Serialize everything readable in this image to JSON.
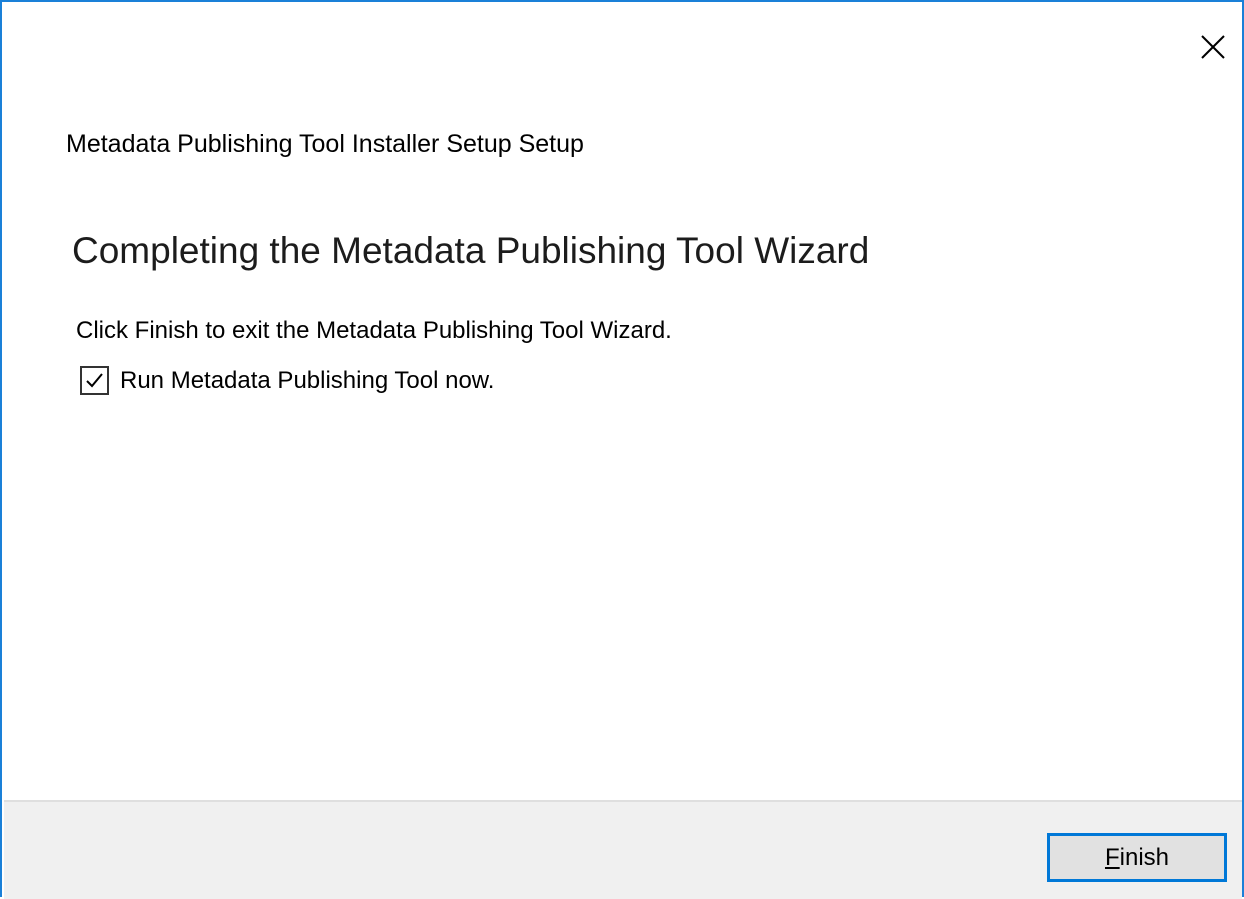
{
  "window": {
    "title": "Metadata Publishing Tool Installer Setup Setup",
    "close_icon": "close-icon"
  },
  "content": {
    "heading": "Completing the Metadata Publishing Tool Wizard",
    "instruction": "Click Finish to exit the Metadata Publishing Tool Wizard.",
    "run_checkbox": {
      "label": "Run Metadata Publishing Tool now.",
      "checked": true
    }
  },
  "footer": {
    "finish_button": {
      "accelerator": "F",
      "rest": "inish"
    }
  },
  "colors": {
    "window_border": "#1a80d8",
    "footer_bg": "#f0f0f0",
    "button_focus_border": "#0078d7",
    "button_bg": "#e1e1e1"
  }
}
